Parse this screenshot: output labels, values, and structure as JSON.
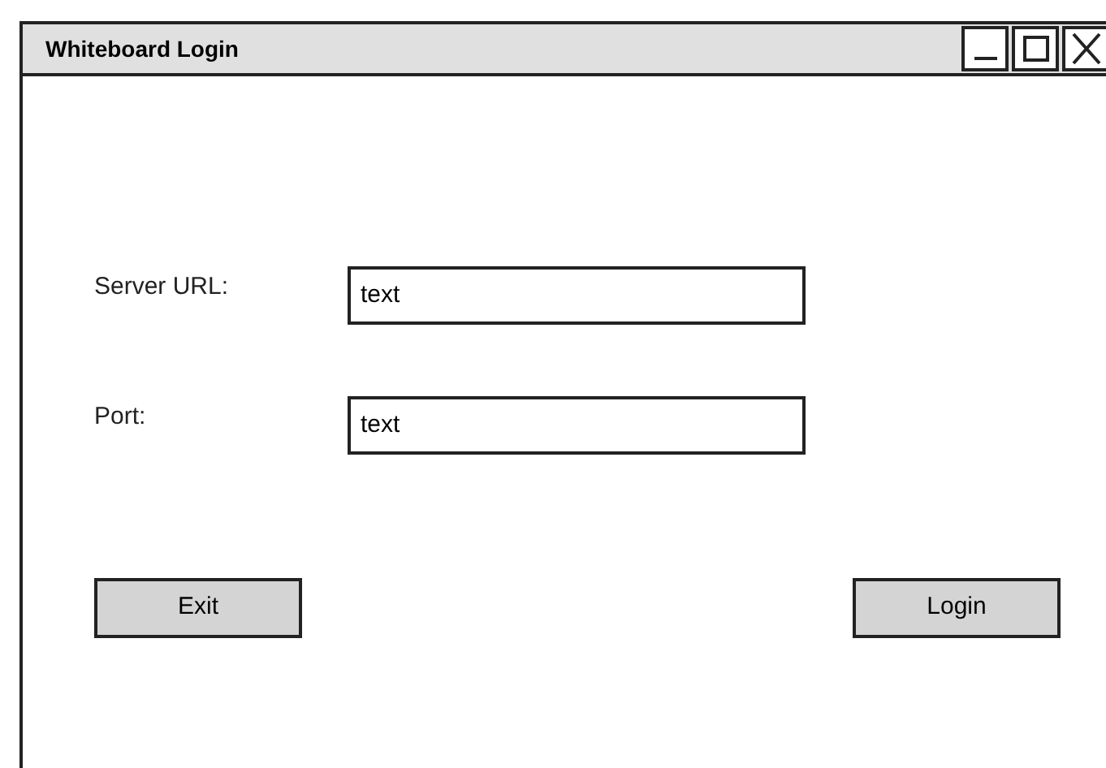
{
  "window": {
    "title": "Whiteboard Login"
  },
  "fields": [
    {
      "label": "Server URL:",
      "value": "text"
    },
    {
      "label": "Port:",
      "value": "text"
    }
  ],
  "buttons": [
    {
      "label": "Exit"
    },
    {
      "label": "Login"
    }
  ]
}
